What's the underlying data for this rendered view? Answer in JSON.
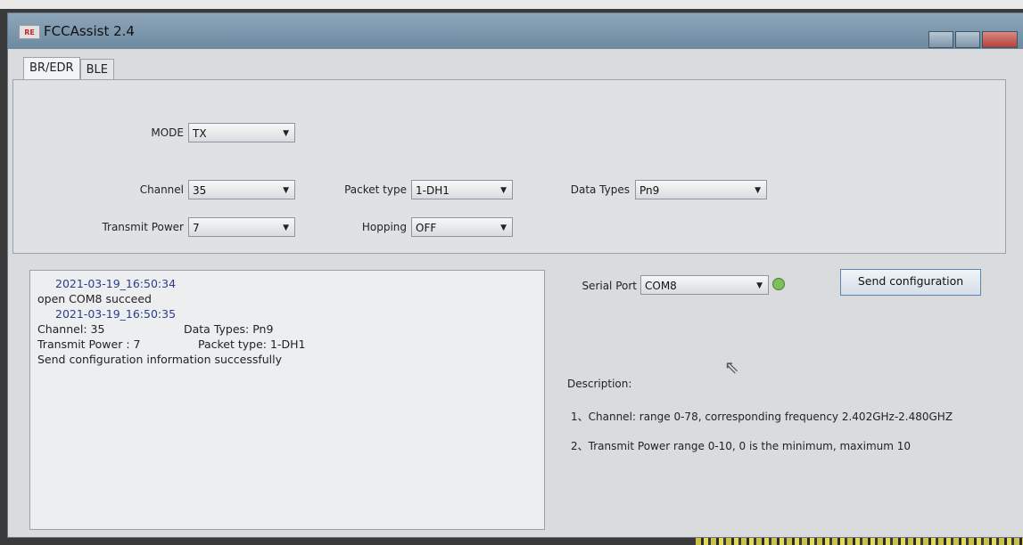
{
  "window": {
    "title": "FCCAssist 2.4",
    "icon_text": "RE"
  },
  "tabs": [
    {
      "label": "BR/EDR"
    },
    {
      "label": "BLE"
    }
  ],
  "config": {
    "mode": {
      "label": "MODE",
      "value": "TX"
    },
    "channel": {
      "label": "Channel",
      "value": "35"
    },
    "transmit_power": {
      "label": "Transmit Power",
      "value": "7"
    },
    "packet_type": {
      "label": "Packet type",
      "value": "1-DH1"
    },
    "hopping": {
      "label": "Hopping",
      "value": "OFF"
    },
    "data_types": {
      "label": "Data Types",
      "value": "Pn9"
    }
  },
  "serial": {
    "label": "Serial Port",
    "value": "COM8",
    "status_color": "#7dbf5a"
  },
  "send_button": {
    "label": "Send configuration"
  },
  "log": {
    "ts1": "2021-03-19_16:50:34",
    "line1": "open COM8 succeed",
    "ts2": "2021-03-19_16:50:35",
    "ch": "Channel: 35",
    "dt": "Data Types: Pn9",
    "tp": "Transmit Power : 7",
    "pt": "Packet type: 1-DH1",
    "ok": "Send configuration information successfully"
  },
  "description": {
    "title": "Description:",
    "line1": "1、Channel: range 0-78, corresponding frequency 2.402GHz-2.480GHZ",
    "line2": "2、Transmit Power  range 0-10, 0 is the minimum, maximum 10"
  },
  "icons": {
    "dropdown": "chevron-down-icon",
    "cursor": "mouse-pointer-icon"
  }
}
